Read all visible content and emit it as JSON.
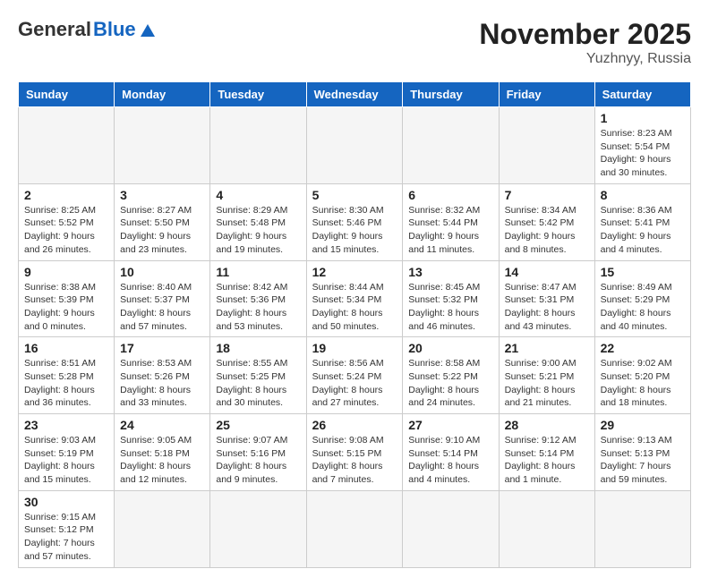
{
  "header": {
    "logo_general": "General",
    "logo_blue": "Blue",
    "month_title": "November 2025",
    "location": "Yuzhnyy, Russia"
  },
  "days_of_week": [
    "Sunday",
    "Monday",
    "Tuesday",
    "Wednesday",
    "Thursday",
    "Friday",
    "Saturday"
  ],
  "weeks": [
    [
      {
        "day": null,
        "info": null
      },
      {
        "day": null,
        "info": null
      },
      {
        "day": null,
        "info": null
      },
      {
        "day": null,
        "info": null
      },
      {
        "day": null,
        "info": null
      },
      {
        "day": null,
        "info": null
      },
      {
        "day": "1",
        "info": "Sunrise: 8:23 AM\nSunset: 5:54 PM\nDaylight: 9 hours and 30 minutes."
      }
    ],
    [
      {
        "day": "2",
        "info": "Sunrise: 8:25 AM\nSunset: 5:52 PM\nDaylight: 9 hours and 26 minutes."
      },
      {
        "day": "3",
        "info": "Sunrise: 8:27 AM\nSunset: 5:50 PM\nDaylight: 9 hours and 23 minutes."
      },
      {
        "day": "4",
        "info": "Sunrise: 8:29 AM\nSunset: 5:48 PM\nDaylight: 9 hours and 19 minutes."
      },
      {
        "day": "5",
        "info": "Sunrise: 8:30 AM\nSunset: 5:46 PM\nDaylight: 9 hours and 15 minutes."
      },
      {
        "day": "6",
        "info": "Sunrise: 8:32 AM\nSunset: 5:44 PM\nDaylight: 9 hours and 11 minutes."
      },
      {
        "day": "7",
        "info": "Sunrise: 8:34 AM\nSunset: 5:42 PM\nDaylight: 9 hours and 8 minutes."
      },
      {
        "day": "8",
        "info": "Sunrise: 8:36 AM\nSunset: 5:41 PM\nDaylight: 9 hours and 4 minutes."
      }
    ],
    [
      {
        "day": "9",
        "info": "Sunrise: 8:38 AM\nSunset: 5:39 PM\nDaylight: 9 hours and 0 minutes."
      },
      {
        "day": "10",
        "info": "Sunrise: 8:40 AM\nSunset: 5:37 PM\nDaylight: 8 hours and 57 minutes."
      },
      {
        "day": "11",
        "info": "Sunrise: 8:42 AM\nSunset: 5:36 PM\nDaylight: 8 hours and 53 minutes."
      },
      {
        "day": "12",
        "info": "Sunrise: 8:44 AM\nSunset: 5:34 PM\nDaylight: 8 hours and 50 minutes."
      },
      {
        "day": "13",
        "info": "Sunrise: 8:45 AM\nSunset: 5:32 PM\nDaylight: 8 hours and 46 minutes."
      },
      {
        "day": "14",
        "info": "Sunrise: 8:47 AM\nSunset: 5:31 PM\nDaylight: 8 hours and 43 minutes."
      },
      {
        "day": "15",
        "info": "Sunrise: 8:49 AM\nSunset: 5:29 PM\nDaylight: 8 hours and 40 minutes."
      }
    ],
    [
      {
        "day": "16",
        "info": "Sunrise: 8:51 AM\nSunset: 5:28 PM\nDaylight: 8 hours and 36 minutes."
      },
      {
        "day": "17",
        "info": "Sunrise: 8:53 AM\nSunset: 5:26 PM\nDaylight: 8 hours and 33 minutes."
      },
      {
        "day": "18",
        "info": "Sunrise: 8:55 AM\nSunset: 5:25 PM\nDaylight: 8 hours and 30 minutes."
      },
      {
        "day": "19",
        "info": "Sunrise: 8:56 AM\nSunset: 5:24 PM\nDaylight: 8 hours and 27 minutes."
      },
      {
        "day": "20",
        "info": "Sunrise: 8:58 AM\nSunset: 5:22 PM\nDaylight: 8 hours and 24 minutes."
      },
      {
        "day": "21",
        "info": "Sunrise: 9:00 AM\nSunset: 5:21 PM\nDaylight: 8 hours and 21 minutes."
      },
      {
        "day": "22",
        "info": "Sunrise: 9:02 AM\nSunset: 5:20 PM\nDaylight: 8 hours and 18 minutes."
      }
    ],
    [
      {
        "day": "23",
        "info": "Sunrise: 9:03 AM\nSunset: 5:19 PM\nDaylight: 8 hours and 15 minutes."
      },
      {
        "day": "24",
        "info": "Sunrise: 9:05 AM\nSunset: 5:18 PM\nDaylight: 8 hours and 12 minutes."
      },
      {
        "day": "25",
        "info": "Sunrise: 9:07 AM\nSunset: 5:16 PM\nDaylight: 8 hours and 9 minutes."
      },
      {
        "day": "26",
        "info": "Sunrise: 9:08 AM\nSunset: 5:15 PM\nDaylight: 8 hours and 7 minutes."
      },
      {
        "day": "27",
        "info": "Sunrise: 9:10 AM\nSunset: 5:14 PM\nDaylight: 8 hours and 4 minutes."
      },
      {
        "day": "28",
        "info": "Sunrise: 9:12 AM\nSunset: 5:14 PM\nDaylight: 8 hours and 1 minute."
      },
      {
        "day": "29",
        "info": "Sunrise: 9:13 AM\nSunset: 5:13 PM\nDaylight: 7 hours and 59 minutes."
      }
    ],
    [
      {
        "day": "30",
        "info": "Sunrise: 9:15 AM\nSunset: 5:12 PM\nDaylight: 7 hours and 57 minutes."
      },
      {
        "day": null,
        "info": null
      },
      {
        "day": null,
        "info": null
      },
      {
        "day": null,
        "info": null
      },
      {
        "day": null,
        "info": null
      },
      {
        "day": null,
        "info": null
      },
      {
        "day": null,
        "info": null
      }
    ]
  ]
}
